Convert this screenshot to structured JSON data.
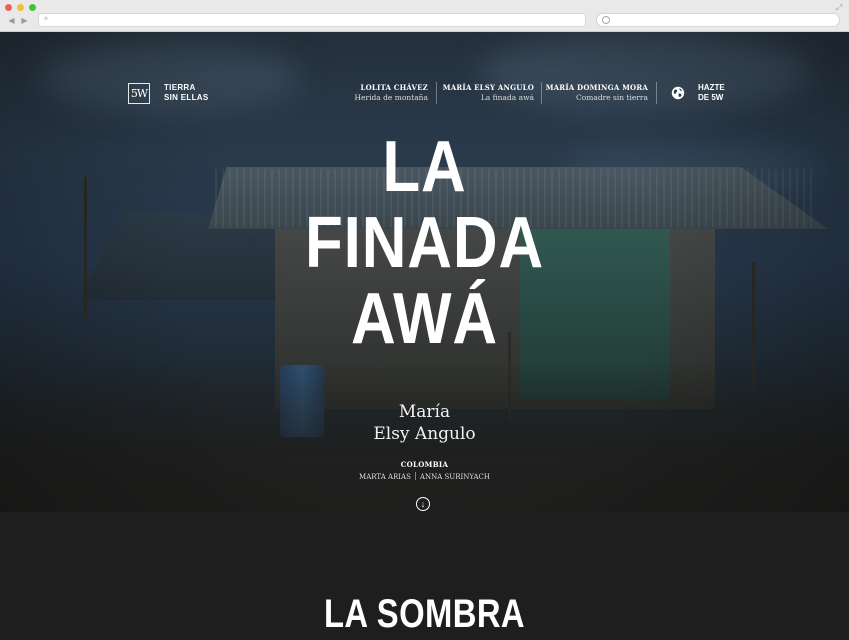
{
  "browser": {
    "back_glyph": "◀",
    "forward_glyph": "▶",
    "new_tab_glyph": "+",
    "expand_glyph": "⤢"
  },
  "header": {
    "logo_text": "5W",
    "brand_line1": "TIERRA",
    "brand_line2": "SIN ELLAS",
    "nav": [
      {
        "name": "LOLITA CHÁVEZ",
        "subtitle": "Herida de montaña"
      },
      {
        "name": "MARÍA ELSY ANGULO",
        "subtitle": "La finada awá"
      },
      {
        "name": "MARÍA DOMINGA MORA",
        "subtitle": "Comadre sin tierra"
      }
    ],
    "join_line1": "HAZTE",
    "join_line2": "DE 5W"
  },
  "hero": {
    "title_lines": [
      "LA",
      "FINADA",
      "AWÁ"
    ],
    "name_lines": [
      "María",
      "Elsy Angulo"
    ],
    "country": "COLOMBIA",
    "credits": [
      "MARTA ARIAS",
      "ANNA SURINYACH"
    ],
    "scroll_glyph": "↓"
  },
  "next_section": {
    "title": "LA SOMBRA"
  },
  "colors": {
    "sky": "#26364a",
    "ground": "#1e1e1e",
    "text": "#ffffff"
  }
}
